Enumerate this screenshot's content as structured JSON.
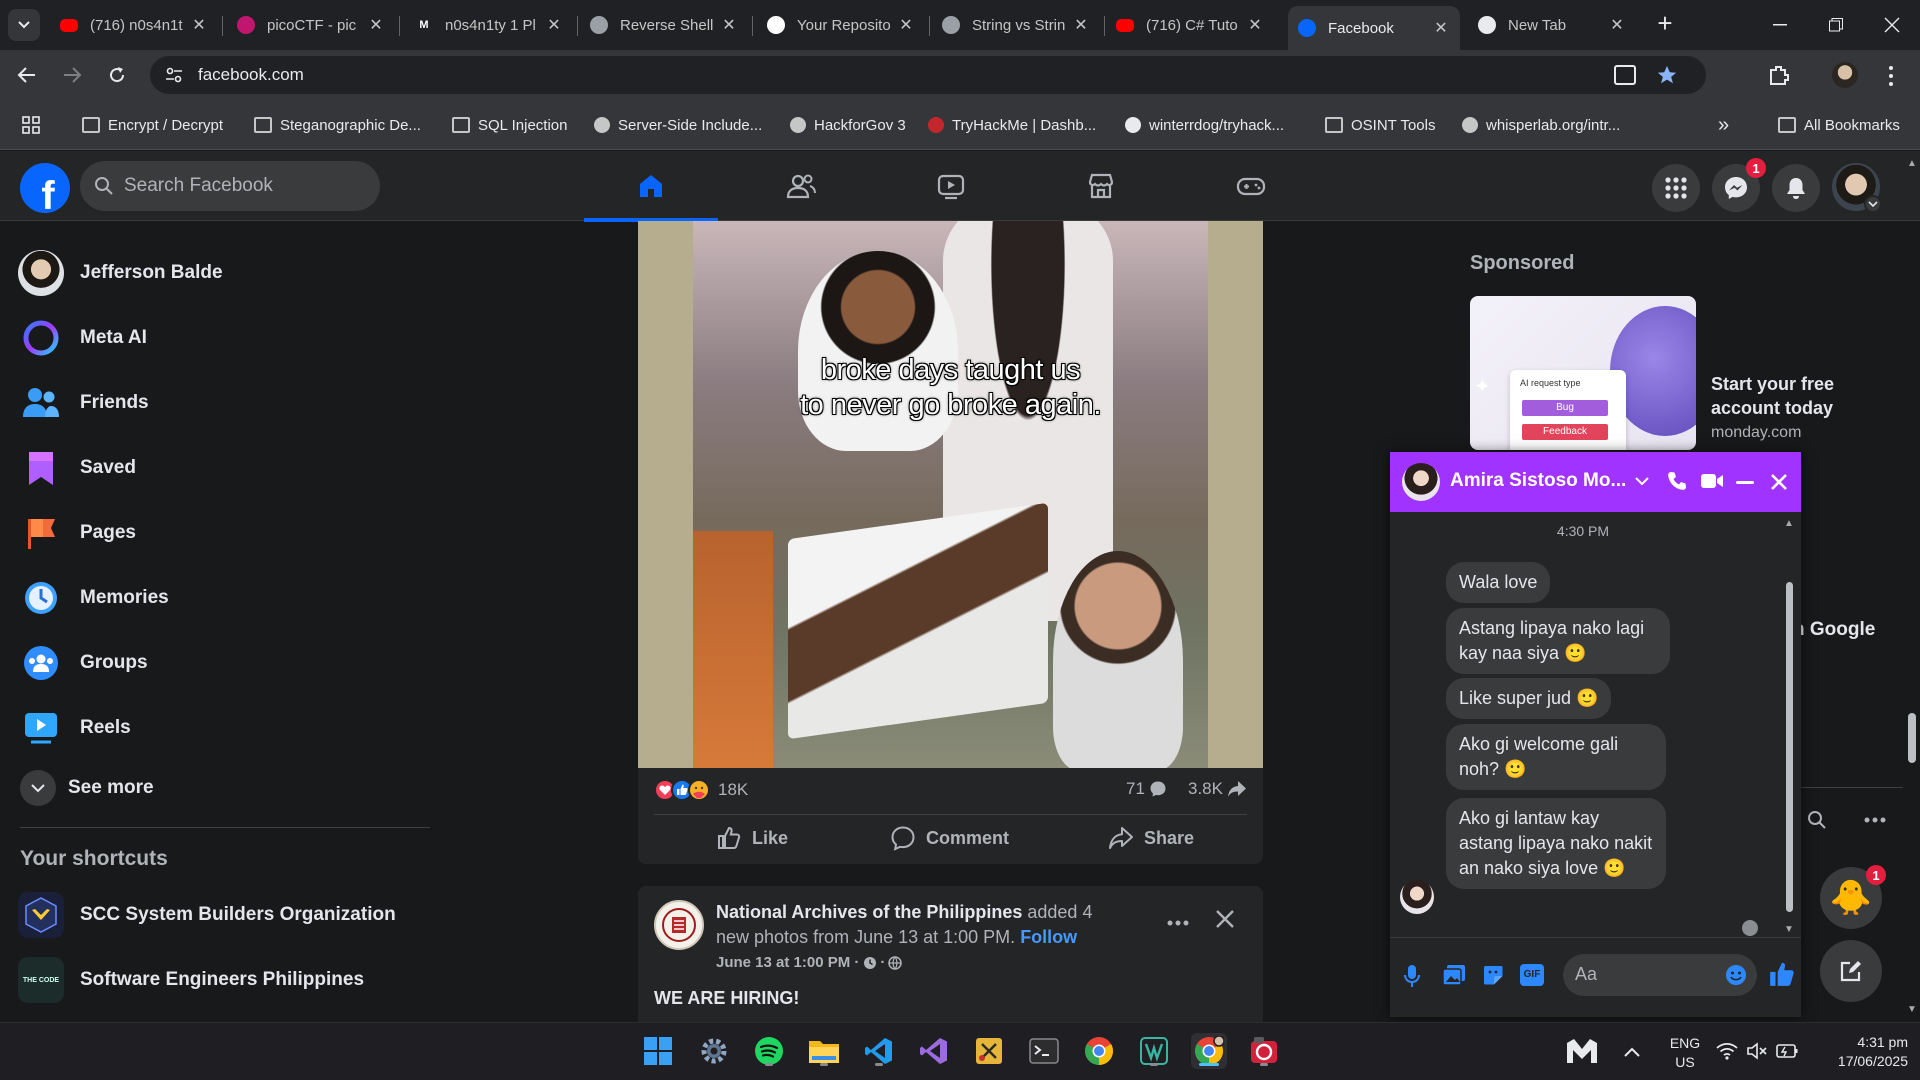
{
  "browser": {
    "tabs": [
      {
        "title": "(716) n0s4n1t",
        "icon": "youtube-icon",
        "color": "#ff0000"
      },
      {
        "title": "picoCTF - pic",
        "icon": "picoctf-icon",
        "color": "#c0166f"
      },
      {
        "title": "n0s4n1ty 1 Pl",
        "icon": "medium-icon",
        "favtext": "M",
        "color": "#202124"
      },
      {
        "title": "Reverse Shell",
        "icon": "globe-icon",
        "color": "#9aa0a6"
      },
      {
        "title": "Your Reposito",
        "icon": "github-icon",
        "color": "#ffffff"
      },
      {
        "title": "String vs Strin",
        "icon": "openai-icon",
        "color": "#9aa0a6"
      },
      {
        "title": "(716) C# Tuto",
        "icon": "youtube-icon",
        "color": "#ff0000"
      },
      {
        "title": "Facebook",
        "icon": "facebook-icon",
        "color": "#0866ff",
        "active": true
      },
      {
        "title": "New Tab",
        "icon": "chrome-icon",
        "color": "#e8eaed"
      }
    ],
    "new_tab_label": "+",
    "url": "facebook.com",
    "bookmarks": [
      {
        "label": "Encrypt / Decrypt",
        "icon": "folder-icon"
      },
      {
        "label": "Steganographic De...",
        "icon": "folder-icon"
      },
      {
        "label": "SQL Injection",
        "icon": "folder-icon"
      },
      {
        "label": "Server-Side Include...",
        "icon": "site-icon"
      },
      {
        "label": "HackforGov 3",
        "icon": "site-icon"
      },
      {
        "label": "TryHackMe | Dashb...",
        "icon": "tryhackme-icon"
      },
      {
        "label": "winterrdog/tryhack...",
        "icon": "github-icon"
      },
      {
        "label": "OSINT Tools",
        "icon": "folder-icon"
      },
      {
        "label": "whisperlab.org/intr...",
        "icon": "site-icon"
      }
    ],
    "all_bookmarks_label": "All Bookmarks",
    "more_label": "»"
  },
  "fb": {
    "search_placeholder": "Search Facebook",
    "messenger_badge": "1",
    "sidebar": [
      {
        "label": "Jefferson Balde",
        "icon": "profile-avatar"
      },
      {
        "label": "Meta AI",
        "icon": "meta-ai-icon"
      },
      {
        "label": "Friends",
        "icon": "friends-icon"
      },
      {
        "label": "Saved",
        "icon": "saved-icon"
      },
      {
        "label": "Pages",
        "icon": "pages-icon"
      },
      {
        "label": "Memories",
        "icon": "memories-icon"
      },
      {
        "label": "Groups",
        "icon": "groups-icon"
      },
      {
        "label": "Reels",
        "icon": "reels-icon"
      }
    ],
    "see_more": "See more",
    "shortcuts_title": "Your shortcuts",
    "shortcuts": [
      {
        "label": "SCC System Builders Organization"
      },
      {
        "label": "Software Engineers Philippines",
        "thumb_text": "THE CODE"
      }
    ],
    "post1": {
      "caption_line1": "broke days taught us",
      "caption_line2": "to never go broke again.",
      "reaction_count": "18K",
      "comment_count": "71",
      "share_count": "3.8K",
      "like_label": "Like",
      "comment_label": "Comment",
      "share_label": "Share"
    },
    "post2": {
      "page_name": "National Archives of the Philippines",
      "action_text": " added 4 new photos from June 13 at 1:00 PM.",
      "follow_label": "Follow",
      "timestamp": "June 13 at 1:00 PM ·",
      "body": "WE ARE HIRING!"
    },
    "sponsored": {
      "title": "Sponsored",
      "ad_headline": "Start your free account today",
      "ad_domain": "monday.com",
      "ad_card_label": "AI request type",
      "ad_chip1": "Bug",
      "ad_chip2": "Feedback",
      "partial_text": "n Google"
    },
    "chat": {
      "contact": "Amira Sistoso Mo...",
      "time": "4:30 PM",
      "messages": [
        "Wala love",
        "Astang lipaya nako lagi kay naa siya 🙂",
        "Like super jud 🙂",
        "Ako gi welcome gali noh? 🙂",
        "Ako gi lantaw kay astang lipaya nako nakit an nako siya love 🙂"
      ],
      "input_placeholder": "Aa",
      "floating_badge": "1"
    }
  },
  "taskbar": {
    "lang_line1": "ENG",
    "lang_line2": "US",
    "time": "4:31 pm",
    "date": "17/06/2025"
  }
}
